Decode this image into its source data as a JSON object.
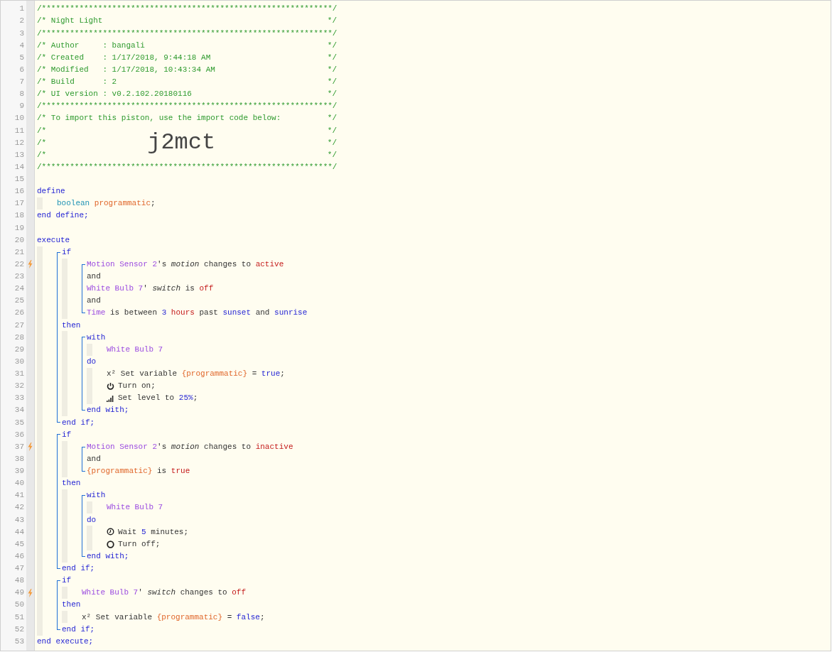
{
  "editor": {
    "lines": [
      {
        "kind": "line",
        "number": "1",
        "trigger": false,
        "tokens": [
          {
            "kind": "comment",
            "text": "/**************************************************************/"
          }
        ]
      },
      {
        "kind": "line",
        "number": "2",
        "trigger": false,
        "tokens": [
          {
            "kind": "comment",
            "text": "/* Night Light"
          },
          {
            "kind": "comment_end",
            "text": "*/"
          }
        ]
      },
      {
        "kind": "line",
        "number": "3",
        "trigger": false,
        "tokens": [
          {
            "kind": "comment",
            "text": "/**************************************************************/"
          }
        ]
      },
      {
        "kind": "line",
        "number": "4",
        "trigger": false,
        "tokens": [
          {
            "kind": "comment",
            "text": "/* Author     : bangali"
          },
          {
            "kind": "comment_end",
            "text": "*/"
          }
        ]
      },
      {
        "kind": "line",
        "number": "5",
        "trigger": false,
        "tokens": [
          {
            "kind": "comment",
            "text": "/* Created    : 1/17/2018, 9:44:18 AM"
          },
          {
            "kind": "comment_end",
            "text": "*/"
          }
        ]
      },
      {
        "kind": "line",
        "number": "6",
        "trigger": false,
        "tokens": [
          {
            "kind": "comment",
            "text": "/* Modified   : 1/17/2018, 10:43:34 AM"
          },
          {
            "kind": "comment_end",
            "text": "*/"
          }
        ]
      },
      {
        "kind": "line",
        "number": "7",
        "trigger": false,
        "tokens": [
          {
            "kind": "comment",
            "text": "/* Build      : 2"
          },
          {
            "kind": "comment_end",
            "text": "*/"
          }
        ]
      },
      {
        "kind": "line",
        "number": "8",
        "trigger": false,
        "tokens": [
          {
            "kind": "comment",
            "text": "/* UI version : v0.2.102.20180116"
          },
          {
            "kind": "comment_end",
            "text": "*/"
          }
        ]
      },
      {
        "kind": "line",
        "number": "9",
        "trigger": false,
        "tokens": [
          {
            "kind": "comment",
            "text": "/**************************************************************/"
          }
        ]
      },
      {
        "kind": "line",
        "number": "10",
        "trigger": false,
        "tokens": [
          {
            "kind": "comment",
            "text": "/* To import this piston, use the import code below:"
          },
          {
            "kind": "comment_end",
            "text": "*/"
          }
        ]
      },
      {
        "kind": "line",
        "number": "11",
        "trigger": false,
        "tokens": [
          {
            "kind": "comment",
            "text": "/*"
          },
          {
            "kind": "comment_end",
            "text": "*/"
          }
        ]
      },
      {
        "kind": "line",
        "number": "12",
        "trigger": false,
        "tokens": [
          {
            "kind": "comment",
            "text": "/*"
          },
          {
            "kind": "code",
            "text": "j2mct"
          },
          {
            "kind": "comment_end",
            "text": "*/"
          }
        ]
      },
      {
        "kind": "line",
        "number": "13",
        "trigger": false,
        "tokens": [
          {
            "kind": "comment",
            "text": "/*"
          },
          {
            "kind": "comment_end",
            "text": "*/"
          }
        ]
      },
      {
        "kind": "line",
        "number": "14",
        "trigger": false,
        "tokens": [
          {
            "kind": "comment",
            "text": "/**************************************************************/"
          }
        ]
      },
      {
        "kind": "line",
        "number": "15",
        "trigger": false
      },
      {
        "kind": "line",
        "number": "16",
        "trigger": false,
        "tokens": [
          {
            "kind": "keyword",
            "text": "define"
          }
        ]
      },
      {
        "kind": "indent",
        "children": [
          {
            "kind": "line",
            "number": "17",
            "trigger": false,
            "tokens": [
              {
                "kind": "type",
                "text": "boolean "
              },
              {
                "kind": "variable",
                "text": "programmatic"
              },
              {
                "kind": "plain",
                "text": ";"
              }
            ]
          }
        ]
      },
      {
        "kind": "line",
        "number": "18",
        "trigger": false,
        "tokens": [
          {
            "kind": "keyword",
            "text": "end define;"
          }
        ]
      },
      {
        "kind": "line",
        "number": "19",
        "trigger": false
      },
      {
        "kind": "line",
        "number": "20",
        "trigger": false,
        "tokens": [
          {
            "kind": "keyword",
            "text": "execute"
          }
        ]
      },
      {
        "kind": "indent",
        "children": [
          {
            "kind": "bracket",
            "children": [
              {
                "kind": "line",
                "number": "21",
                "trigger": false,
                "tokens": [
                  {
                    "kind": "keyword",
                    "text": "if"
                  }
                ]
              },
              {
                "kind": "indent",
                "children": [
                  {
                    "kind": "bracket",
                    "children": [
                      {
                        "kind": "line",
                        "number": "22",
                        "trigger": true,
                        "tokens": [
                          {
                            "kind": "device",
                            "text": "Motion Sensor 2"
                          },
                          {
                            "kind": "plain",
                            "text": "'s "
                          },
                          {
                            "kind": "attribute",
                            "text": "motion"
                          },
                          {
                            "kind": "plain",
                            "text": " changes to "
                          },
                          {
                            "kind": "value",
                            "text": "active"
                          }
                        ]
                      },
                      {
                        "kind": "line",
                        "number": "23",
                        "trigger": false,
                        "tokens": [
                          {
                            "kind": "plain",
                            "text": "and"
                          }
                        ]
                      },
                      {
                        "kind": "line",
                        "number": "24",
                        "trigger": false,
                        "tokens": [
                          {
                            "kind": "device",
                            "text": "White Bulb 7"
                          },
                          {
                            "kind": "plain",
                            "text": "' "
                          },
                          {
                            "kind": "attribute",
                            "text": "switch"
                          },
                          {
                            "kind": "plain",
                            "text": " is "
                          },
                          {
                            "kind": "value",
                            "text": "off"
                          }
                        ]
                      },
                      {
                        "kind": "line",
                        "number": "25",
                        "trigger": false,
                        "tokens": [
                          {
                            "kind": "plain",
                            "text": "and"
                          }
                        ]
                      },
                      {
                        "kind": "line",
                        "number": "26",
                        "trigger": false,
                        "tokens": [
                          {
                            "kind": "device",
                            "text": "Time"
                          },
                          {
                            "kind": "plain",
                            "text": " is between "
                          },
                          {
                            "kind": "literal",
                            "text": "3 "
                          },
                          {
                            "kind": "value",
                            "text": "hours"
                          },
                          {
                            "kind": "plain",
                            "text": " past "
                          },
                          {
                            "kind": "literal",
                            "text": "sunset"
                          },
                          {
                            "kind": "plain",
                            "text": " and "
                          },
                          {
                            "kind": "literal",
                            "text": "sunrise"
                          }
                        ]
                      }
                    ]
                  }
                ]
              },
              {
                "kind": "line",
                "number": "27",
                "trigger": false,
                "tokens": [
                  {
                    "kind": "keyword",
                    "text": "then"
                  }
                ]
              },
              {
                "kind": "indent",
                "children": [
                  {
                    "kind": "bracket",
                    "children": [
                      {
                        "kind": "line",
                        "number": "28",
                        "trigger": false,
                        "tokens": [
                          {
                            "kind": "keyword",
                            "text": "with"
                          }
                        ]
                      },
                      {
                        "kind": "indent",
                        "children": [
                          {
                            "kind": "line",
                            "number": "29",
                            "trigger": false,
                            "tokens": [
                              {
                                "kind": "device",
                                "text": "White Bulb 7"
                              }
                            ]
                          }
                        ]
                      },
                      {
                        "kind": "line",
                        "number": "30",
                        "trigger": false,
                        "tokens": [
                          {
                            "kind": "keyword",
                            "text": "do"
                          }
                        ]
                      },
                      {
                        "kind": "indent",
                        "children": [
                          {
                            "kind": "line",
                            "number": "31",
                            "trigger": false,
                            "tokens": [
                              {
                                "kind": "plain",
                                "text": "x² Set variable "
                              },
                              {
                                "kind": "variable",
                                "text": "{programmatic}"
                              },
                              {
                                "kind": "plain",
                                "text": " = "
                              },
                              {
                                "kind": "literal",
                                "text": "true"
                              },
                              {
                                "kind": "plain",
                                "text": ";"
                              }
                            ]
                          },
                          {
                            "kind": "line",
                            "number": "32",
                            "trigger": false,
                            "tokens": [
                              {
                                "kind": "power"
                              },
                              {
                                "kind": "plain",
                                "text": "Turn on;"
                              }
                            ]
                          },
                          {
                            "kind": "line",
                            "number": "33",
                            "trigger": false,
                            "tokens": [
                              {
                                "kind": "bars"
                              },
                              {
                                "kind": "plain",
                                "text": "Set level to "
                              },
                              {
                                "kind": "literal",
                                "text": "25%"
                              },
                              {
                                "kind": "plain",
                                "text": ";"
                              }
                            ]
                          }
                        ]
                      },
                      {
                        "kind": "line",
                        "number": "34",
                        "trigger": false,
                        "tokens": [
                          {
                            "kind": "keyword",
                            "text": "end with;"
                          }
                        ]
                      }
                    ]
                  }
                ]
              },
              {
                "kind": "line",
                "number": "35",
                "trigger": false,
                "tokens": [
                  {
                    "kind": "keyword",
                    "text": "end if;"
                  }
                ]
              }
            ]
          },
          {
            "kind": "bracket",
            "children": [
              {
                "kind": "line",
                "number": "36",
                "trigger": false,
                "tokens": [
                  {
                    "kind": "keyword",
                    "text": "if"
                  }
                ]
              },
              {
                "kind": "indent",
                "children": [
                  {
                    "kind": "bracket",
                    "children": [
                      {
                        "kind": "line",
                        "number": "37",
                        "trigger": true,
                        "tokens": [
                          {
                            "kind": "device",
                            "text": "Motion Sensor 2"
                          },
                          {
                            "kind": "plain",
                            "text": "'s "
                          },
                          {
                            "kind": "attribute",
                            "text": "motion"
                          },
                          {
                            "kind": "plain",
                            "text": " changes to "
                          },
                          {
                            "kind": "value",
                            "text": "inactive"
                          }
                        ]
                      },
                      {
                        "kind": "line",
                        "number": "38",
                        "trigger": false,
                        "tokens": [
                          {
                            "kind": "plain",
                            "text": "and"
                          }
                        ]
                      },
                      {
                        "kind": "line",
                        "number": "39",
                        "trigger": false,
                        "tokens": [
                          {
                            "kind": "variable",
                            "text": "{programmatic}"
                          },
                          {
                            "kind": "plain",
                            "text": " is "
                          },
                          {
                            "kind": "value",
                            "text": "true"
                          }
                        ]
                      }
                    ]
                  }
                ]
              },
              {
                "kind": "line",
                "number": "40",
                "trigger": false,
                "tokens": [
                  {
                    "kind": "keyword",
                    "text": "then"
                  }
                ]
              },
              {
                "kind": "indent",
                "children": [
                  {
                    "kind": "bracket",
                    "children": [
                      {
                        "kind": "line",
                        "number": "41",
                        "trigger": false,
                        "tokens": [
                          {
                            "kind": "keyword",
                            "text": "with"
                          }
                        ]
                      },
                      {
                        "kind": "indent",
                        "children": [
                          {
                            "kind": "line",
                            "number": "42",
                            "trigger": false,
                            "tokens": [
                              {
                                "kind": "device",
                                "text": "White Bulb 7"
                              }
                            ]
                          }
                        ]
                      },
                      {
                        "kind": "line",
                        "number": "43",
                        "trigger": false,
                        "tokens": [
                          {
                            "kind": "keyword",
                            "text": "do"
                          }
                        ]
                      },
                      {
                        "kind": "indent",
                        "children": [
                          {
                            "kind": "line",
                            "number": "44",
                            "trigger": false,
                            "tokens": [
                              {
                                "kind": "clock"
                              },
                              {
                                "kind": "plain",
                                "text": "Wait "
                              },
                              {
                                "kind": "literal",
                                "text": "5"
                              },
                              {
                                "kind": "plain",
                                "text": " minutes;"
                              }
                            ]
                          },
                          {
                            "kind": "line",
                            "number": "45",
                            "trigger": false,
                            "tokens": [
                              {
                                "kind": "ring"
                              },
                              {
                                "kind": "plain",
                                "text": "Turn off;"
                              }
                            ]
                          }
                        ]
                      },
                      {
                        "kind": "line",
                        "number": "46",
                        "trigger": false,
                        "tokens": [
                          {
                            "kind": "keyword",
                            "text": "end with;"
                          }
                        ]
                      }
                    ]
                  }
                ]
              },
              {
                "kind": "line",
                "number": "47",
                "trigger": false,
                "tokens": [
                  {
                    "kind": "keyword",
                    "text": "end if;"
                  }
                ]
              }
            ]
          },
          {
            "kind": "bracket",
            "children": [
              {
                "kind": "line",
                "number": "48",
                "trigger": false,
                "tokens": [
                  {
                    "kind": "keyword",
                    "text": "if"
                  }
                ]
              },
              {
                "kind": "indent",
                "children": [
                  {
                    "kind": "line",
                    "number": "49",
                    "trigger": true,
                    "tokens": [
                      {
                        "kind": "device",
                        "text": "White Bulb 7"
                      },
                      {
                        "kind": "plain",
                        "text": "' "
                      },
                      {
                        "kind": "attribute",
                        "text": "switch"
                      },
                      {
                        "kind": "plain",
                        "text": " changes to "
                      },
                      {
                        "kind": "value",
                        "text": "off"
                      }
                    ]
                  }
                ]
              },
              {
                "kind": "line",
                "number": "50",
                "trigger": false,
                "tokens": [
                  {
                    "kind": "keyword",
                    "text": "then"
                  }
                ]
              },
              {
                "kind": "indent",
                "children": [
                  {
                    "kind": "line",
                    "number": "51",
                    "trigger": false,
                    "tokens": [
                      {
                        "kind": "plain",
                        "text": "x² Set variable "
                      },
                      {
                        "kind": "variable",
                        "text": "{programmatic}"
                      },
                      {
                        "kind": "plain",
                        "text": " = "
                      },
                      {
                        "kind": "literal",
                        "text": "false"
                      },
                      {
                        "kind": "plain",
                        "text": ";"
                      }
                    ]
                  }
                ]
              },
              {
                "kind": "line",
                "number": "52",
                "trigger": false,
                "tokens": [
                  {
                    "kind": "keyword",
                    "text": "end if;"
                  }
                ]
              }
            ]
          }
        ]
      },
      {
        "kind": "line",
        "number": "53",
        "trigger": false,
        "tokens": [
          {
            "kind": "keyword",
            "text": "end execute;"
          }
        ]
      }
    ]
  }
}
